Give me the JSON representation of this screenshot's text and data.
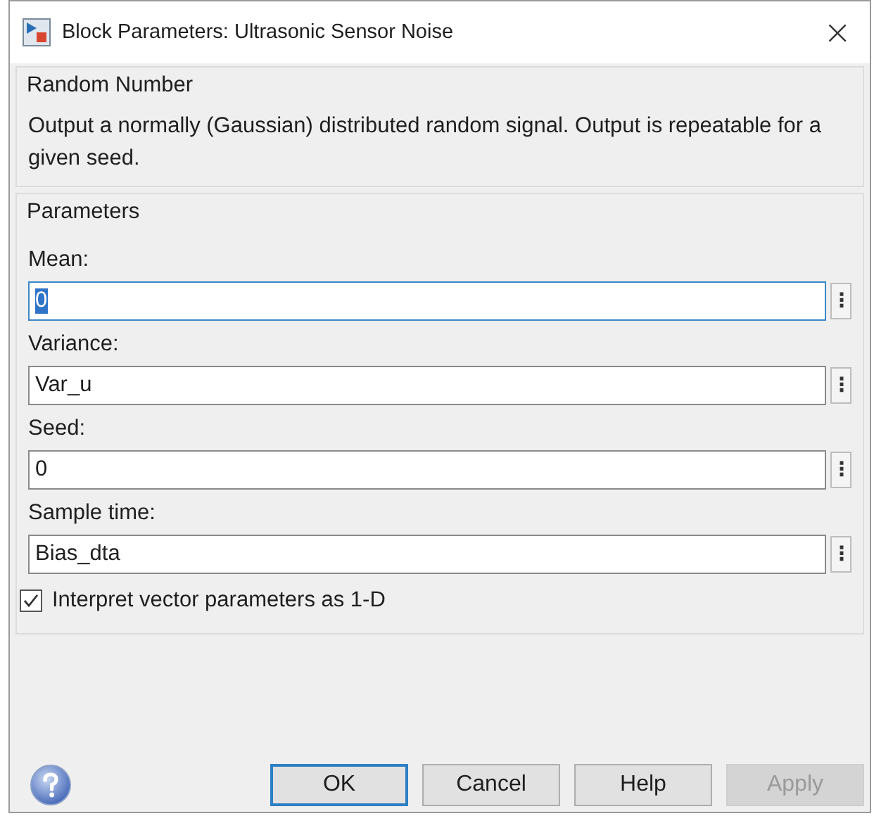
{
  "window": {
    "title": "Block Parameters: Ultrasonic Sensor Noise",
    "close": "×"
  },
  "description_group": {
    "title": "Random Number",
    "text": "Output a normally (Gaussian) distributed random signal.  Output is repeatable for a given seed."
  },
  "parameters_group": {
    "title": "Parameters",
    "fields": [
      {
        "label": "Mean:",
        "value": "0",
        "focused": true,
        "menu": "⋮"
      },
      {
        "label": "Variance:",
        "value": "Var_u",
        "focused": false,
        "menu": "⋮"
      },
      {
        "label": "Seed:",
        "value": "0",
        "focused": false,
        "menu": "⋮"
      },
      {
        "label": "Sample time:",
        "value": "Bias_dta",
        "focused": false,
        "menu": "⋮"
      }
    ],
    "checkbox": {
      "label": "Interpret vector parameters as 1-D",
      "checked": true
    }
  },
  "buttons": [
    {
      "label": "OK",
      "default": true,
      "disabled": false
    },
    {
      "label": "Cancel",
      "default": false,
      "disabled": false
    },
    {
      "label": "Help",
      "default": false,
      "disabled": false
    },
    {
      "label": "Apply",
      "default": false,
      "disabled": true
    }
  ]
}
